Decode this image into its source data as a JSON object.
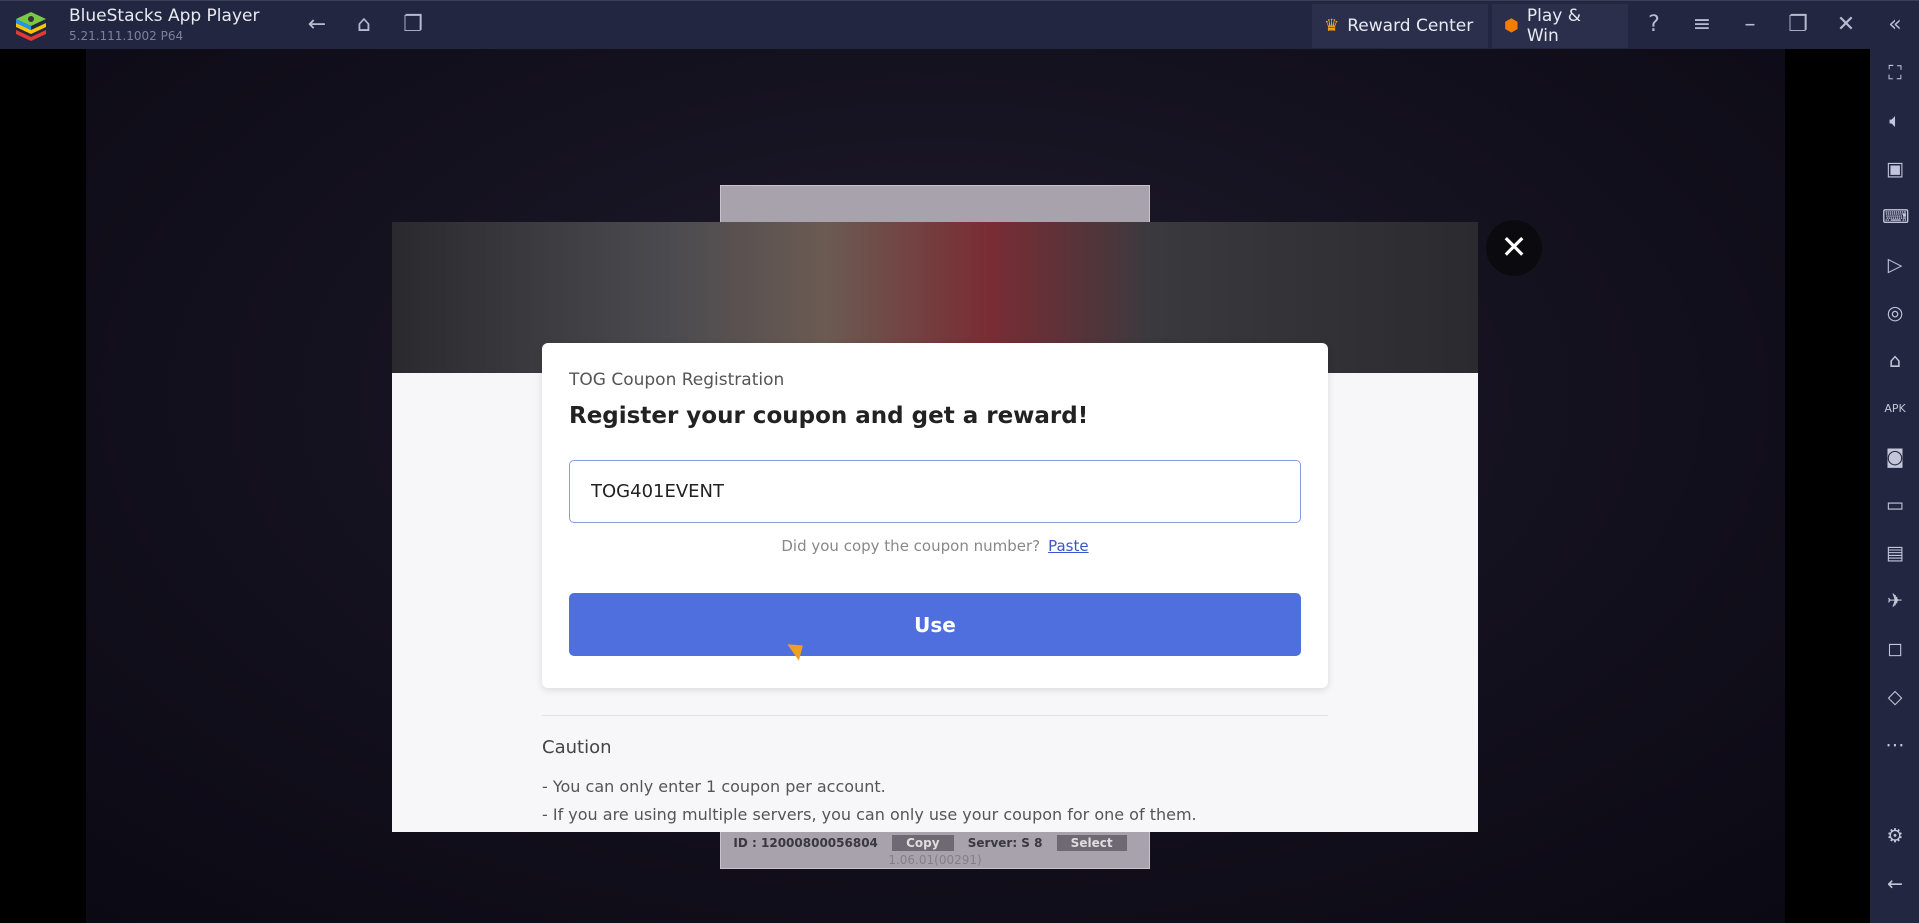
{
  "titlebar": {
    "title": "BlueStacks App Player",
    "version": "5.21.111.1002  P64",
    "reward_center": "Reward Center",
    "play_win": "Play & Win",
    "icons": [
      "back-icon",
      "home-icon",
      "multi-instance-icon",
      "help-icon",
      "menu-icon",
      "minimize-icon",
      "restore-icon",
      "close-icon",
      "collapse-sidebar-icon"
    ]
  },
  "sidebar": {
    "items": [
      "fullscreen-icon",
      "volume-icon",
      "pointer-icon",
      "keyboard-icon",
      "macro-icon",
      "sync-icon",
      "performance-icon",
      "install-apk-icon",
      "screenshot-icon",
      "record-icon",
      "media-folder-icon",
      "airplane-mode-icon",
      "multi-window-icon",
      "rotate-icon",
      "more-icon",
      "settings-icon",
      "back-icon"
    ]
  },
  "background_panel": {
    "id_label": "ID : 12000800056804",
    "copy": "Copy",
    "server": "Server:  S 8",
    "select": "Select",
    "version": "1.06.01(00291)"
  },
  "coupon": {
    "subtitle": "TOG Coupon Registration",
    "title": "Register your coupon and get a reward!",
    "input_value": "TOG401EVENT",
    "paste_prompt": "Did you copy the coupon number?",
    "paste_link": "Paste",
    "use_button": "Use"
  },
  "caution": {
    "title": "Caution",
    "items": [
      "- You can only enter 1 coupon per account.",
      "- If you are using multiple servers, you can only use your coupon for one of them."
    ]
  },
  "colors": {
    "titlebar": "#232640",
    "accent": "#4f6fde",
    "link": "#3a56c8"
  }
}
